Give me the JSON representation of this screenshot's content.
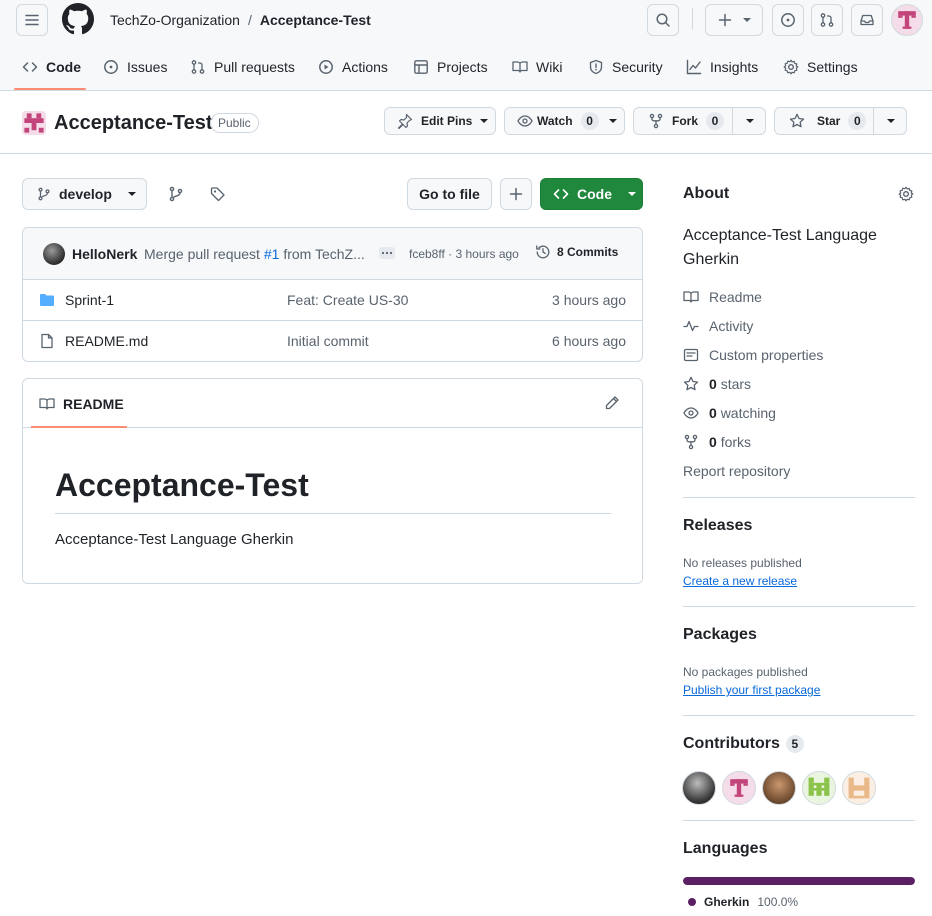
{
  "header": {
    "org": "TechZo-Organization",
    "separator": "/",
    "repo": "Acceptance-Test"
  },
  "tabs": [
    {
      "label": "Code",
      "icon": "code-icon"
    },
    {
      "label": "Issues",
      "icon": "issue-icon"
    },
    {
      "label": "Pull requests",
      "icon": "pull-request-icon"
    },
    {
      "label": "Actions",
      "icon": "play-icon"
    },
    {
      "label": "Projects",
      "icon": "table-icon"
    },
    {
      "label": "Wiki",
      "icon": "book-icon"
    },
    {
      "label": "Security",
      "icon": "shield-icon"
    },
    {
      "label": "Insights",
      "icon": "graph-icon"
    },
    {
      "label": "Settings",
      "icon": "gear-icon"
    }
  ],
  "repo_header": {
    "name": "Acceptance-Test",
    "visibility": "Public",
    "edit_pins": "Edit Pins",
    "watch": "Watch",
    "watch_count": "0",
    "fork": "Fork",
    "fork_count": "0",
    "star": "Star",
    "star_count": "0"
  },
  "toolbar": {
    "branch": "develop",
    "go_to_file": "Go to file",
    "code_button": "Code"
  },
  "latest_commit": {
    "author": "HelloNerk",
    "message_prefix": "Merge pull request",
    "pr_ref": "#1",
    "message_suffix": "from TechZ...",
    "sha_time": "fceb8ff · 3 hours ago",
    "commits": "8 Commits"
  },
  "files": [
    {
      "name": "Sprint-1",
      "type": "folder",
      "message": "Feat: Create US-30",
      "time": "3 hours ago"
    },
    {
      "name": "README.md",
      "type": "file",
      "message": "Initial commit",
      "time": "6 hours ago"
    }
  ],
  "readme": {
    "tab": "README",
    "title": "Acceptance-Test",
    "body": "Acceptance-Test Language Gherkin"
  },
  "about": {
    "heading": "About",
    "description": "Acceptance-Test Language Gherkin",
    "readme": "Readme",
    "activity": "Activity",
    "custom_properties": "Custom properties",
    "stars_count": "0",
    "stars_label": "stars",
    "watching_count": "0",
    "watching_label": "watching",
    "forks_count": "0",
    "forks_label": "forks",
    "report": "Report repository"
  },
  "releases": {
    "heading": "Releases",
    "none": "No releases published",
    "link": "Create a new release"
  },
  "packages": {
    "heading": "Packages",
    "none": "No packages published",
    "link": "Publish your first package"
  },
  "contributors": {
    "heading": "Contributors",
    "count": "5"
  },
  "languages": {
    "heading": "Languages",
    "items": [
      {
        "name": "Gherkin",
        "percent": "100.0%",
        "fraction": 1.0,
        "color": "#5b2063"
      }
    ]
  },
  "colors": {
    "accent_tab": "#fd8c73",
    "primary_button": "#1f883d",
    "link": "#0969da"
  }
}
